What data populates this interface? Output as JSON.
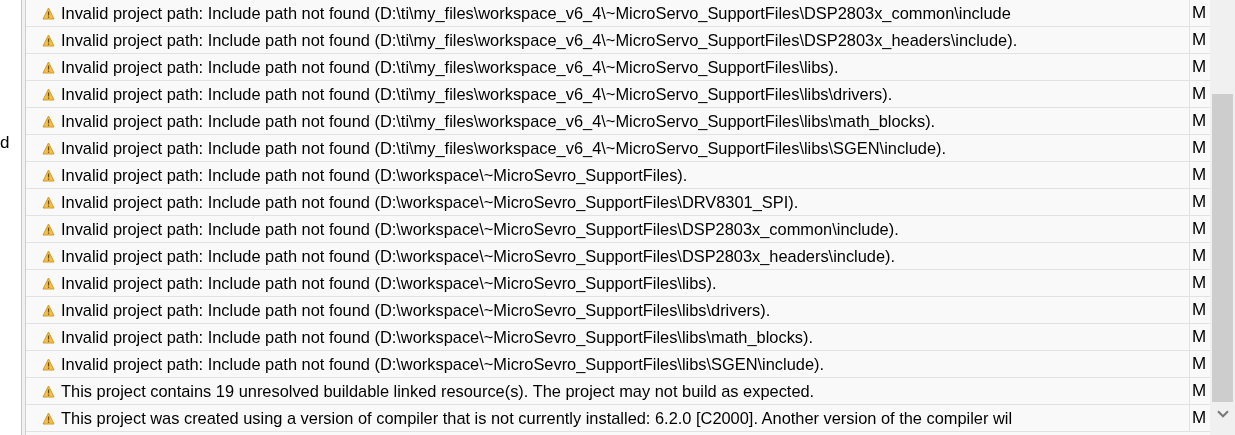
{
  "side_panel": {
    "text": "d"
  },
  "problems": [
    {
      "message": "Invalid project path: Include path not found (D:\\ti\\my_files\\workspace_v6_4\\~MicroServo_SupportFiles\\DSP2803x_common\\include",
      "column_2": "M"
    },
    {
      "message": "Invalid project path: Include path not found (D:\\ti\\my_files\\workspace_v6_4\\~MicroServo_SupportFiles\\DSP2803x_headers\\include).",
      "column_2": "M"
    },
    {
      "message": "Invalid project path: Include path not found (D:\\ti\\my_files\\workspace_v6_4\\~MicroServo_SupportFiles\\libs).",
      "column_2": "M"
    },
    {
      "message": "Invalid project path: Include path not found (D:\\ti\\my_files\\workspace_v6_4\\~MicroServo_SupportFiles\\libs\\drivers).",
      "column_2": "M"
    },
    {
      "message": "Invalid project path: Include path not found (D:\\ti\\my_files\\workspace_v6_4\\~MicroServo_SupportFiles\\libs\\math_blocks).",
      "column_2": "M"
    },
    {
      "message": "Invalid project path: Include path not found (D:\\ti\\my_files\\workspace_v6_4\\~MicroServo_SupportFiles\\libs\\SGEN\\include).",
      "column_2": "M"
    },
    {
      "message": "Invalid project path: Include path not found (D:\\workspace\\~MicroSevro_SupportFiles).",
      "column_2": "M"
    },
    {
      "message": "Invalid project path: Include path not found (D:\\workspace\\~MicroSevro_SupportFiles\\DRV8301_SPI).",
      "column_2": "M"
    },
    {
      "message": "Invalid project path: Include path not found (D:\\workspace\\~MicroSevro_SupportFiles\\DSP2803x_common\\include).",
      "column_2": "M"
    },
    {
      "message": "Invalid project path: Include path not found (D:\\workspace\\~MicroSevro_SupportFiles\\DSP2803x_headers\\include).",
      "column_2": "M"
    },
    {
      "message": "Invalid project path: Include path not found (D:\\workspace\\~MicroSevro_SupportFiles\\libs).",
      "column_2": "M"
    },
    {
      "message": "Invalid project path: Include path not found (D:\\workspace\\~MicroSevro_SupportFiles\\libs\\drivers).",
      "column_2": "M"
    },
    {
      "message": "Invalid project path: Include path not found (D:\\workspace\\~MicroSevro_SupportFiles\\libs\\math_blocks).",
      "column_2": "M"
    },
    {
      "message": "Invalid project path: Include path not found (D:\\workspace\\~MicroSevro_SupportFiles\\libs\\SGEN\\include).",
      "column_2": "M"
    },
    {
      "message": "This project contains 19 unresolved buildable linked resource(s). The project may not build as expected.",
      "column_2": "M"
    },
    {
      "message": "This project was created using a version of compiler that is not currently installed: 6.2.0 [C2000]. Another version of the compiler wil",
      "column_2": "M"
    }
  ]
}
